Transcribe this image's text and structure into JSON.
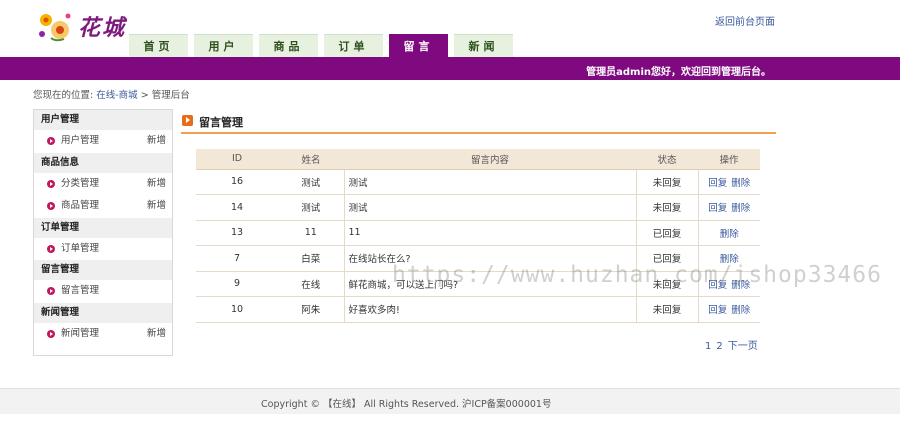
{
  "header": {
    "logo_text": "花城",
    "back_link": "返回前台页面",
    "welcome": "管理员admin您好，欢迎回到管理后台。"
  },
  "nav": {
    "tabs": [
      "首页",
      "用户",
      "商品",
      "订单",
      "留言",
      "新闻"
    ],
    "active_index": 4
  },
  "breadcrumb": {
    "prefix": "您现在的位置:",
    "link": "在线-商城",
    "separator": ">",
    "current": "管理后台"
  },
  "sidebar": {
    "groups": [
      {
        "title": "用户管理",
        "items": [
          {
            "label": "用户管理",
            "add": "新增"
          }
        ]
      },
      {
        "title": "商品信息",
        "items": [
          {
            "label": "分类管理",
            "add": "新增"
          },
          {
            "label": "商品管理",
            "add": "新增"
          }
        ]
      },
      {
        "title": "订单管理",
        "items": [
          {
            "label": "订单管理",
            "add": ""
          }
        ]
      },
      {
        "title": "留言管理",
        "items": [
          {
            "label": "留言管理",
            "add": ""
          }
        ]
      },
      {
        "title": "新闻管理",
        "items": [
          {
            "label": "新闻管理",
            "add": "新增"
          }
        ]
      }
    ]
  },
  "main": {
    "section_title": "留言管理",
    "table": {
      "headers": [
        "ID",
        "姓名",
        "留言内容",
        "状态",
        "操作"
      ],
      "rows": [
        {
          "id": "16",
          "name": "测试",
          "content": "测试",
          "status": "未回复",
          "reply": "回复",
          "delete": "删除"
        },
        {
          "id": "14",
          "name": "测试",
          "content": "测试",
          "status": "未回复",
          "reply": "回复",
          "delete": "删除"
        },
        {
          "id": "13",
          "name": "11",
          "content": "11",
          "status": "已回复",
          "reply": "",
          "delete": "删除"
        },
        {
          "id": "7",
          "name": "白菜",
          "content": "在线站长在么?",
          "status": "已回复",
          "reply": "",
          "delete": "删除"
        },
        {
          "id": "9",
          "name": "在线",
          "content": "鲜花商城，可以送上门吗?",
          "status": "未回复",
          "reply": "回复",
          "delete": "删除"
        },
        {
          "id": "10",
          "name": "阿朱",
          "content": "好喜欢多肉!",
          "status": "未回复",
          "reply": "回复",
          "delete": "删除"
        }
      ]
    },
    "pager": {
      "pages": [
        "1",
        "2"
      ],
      "next": "下一页"
    }
  },
  "watermark": "https://www.huzhan.com/ishop33466",
  "footer": {
    "copyright": "Copyright © 【在线】 All Rights Reserved. 沪ICP备案000001号"
  },
  "colors": {
    "brand_purple": "#7f0a7f",
    "tab_bg": "#e6f1df",
    "accent_orange": "#f0a050",
    "link": "#3a5a9a"
  }
}
